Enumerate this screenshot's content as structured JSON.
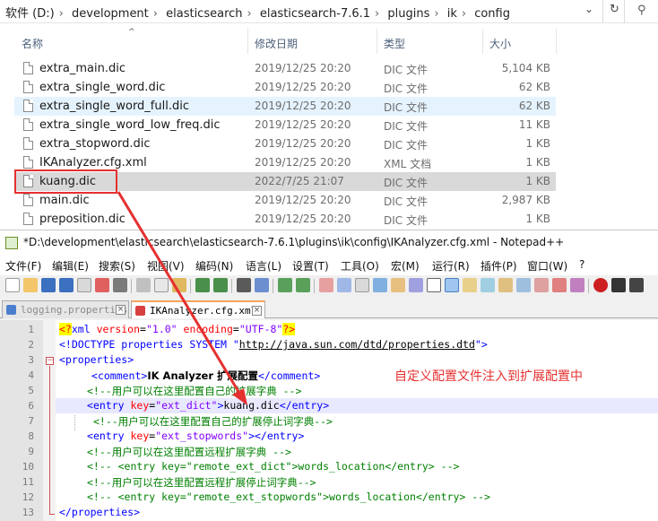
{
  "explorer": {
    "breadcrumb": [
      "软件 (D:)",
      "development",
      "elasticsearch",
      "elasticsearch-7.6.1",
      "plugins",
      "ik",
      "config"
    ],
    "columns": {
      "name": "名称",
      "date": "修改日期",
      "type": "类型",
      "size": "大小"
    },
    "files": [
      {
        "name": "extra_main.dic",
        "date": "2019/12/25 20:20",
        "type": "DIC 文件",
        "size": "5,104 KB"
      },
      {
        "name": "extra_single_word.dic",
        "date": "2019/12/25 20:20",
        "type": "DIC 文件",
        "size": "62 KB"
      },
      {
        "name": "extra_single_word_full.dic",
        "date": "2019/12/25 20:20",
        "type": "DIC 文件",
        "size": "62 KB"
      },
      {
        "name": "extra_single_word_low_freq.dic",
        "date": "2019/12/25 20:20",
        "type": "DIC 文件",
        "size": "11 KB"
      },
      {
        "name": "extra_stopword.dic",
        "date": "2019/12/25 20:20",
        "type": "DIC 文件",
        "size": "1 KB"
      },
      {
        "name": "IKAnalyzer.cfg.xml",
        "date": "2019/12/25 20:20",
        "type": "XML 文档",
        "size": "1 KB"
      },
      {
        "name": "kuang.dic",
        "date": "2022/7/25 21:07",
        "type": "DIC 文件",
        "size": "1 KB"
      },
      {
        "name": "main.dic",
        "date": "2019/12/25 20:20",
        "type": "DIC 文件",
        "size": "2,987 KB"
      },
      {
        "name": "preposition.dic",
        "date": "2019/12/25 20:20",
        "type": "DIC 文件",
        "size": "1 KB"
      }
    ]
  },
  "notepad": {
    "title": "*D:\\development\\elasticsearch\\elasticsearch-7.6.1\\plugins\\ik\\config\\IKAnalyzer.cfg.xml - Notepad++",
    "menu": [
      "文件(F)",
      "编辑(E)",
      "搜索(S)",
      "视图(V)",
      "编码(N)",
      "语言(L)",
      "设置(T)",
      "工具(O)",
      "宏(M)",
      "运行(R)",
      "插件(P)",
      "窗口(W)",
      "?"
    ],
    "tabs": [
      {
        "label": "logging.properties",
        "active": false
      },
      {
        "label": "IKAnalyzer.cfg.xml",
        "active": true
      }
    ],
    "line_numbers": [
      "1",
      "2",
      "3",
      "4",
      "5",
      "6",
      "7",
      "8",
      "9",
      "10",
      "11",
      "12",
      "13"
    ],
    "code": {
      "l1": {
        "a": "<?",
        "b": "xml",
        "c": " version",
        "d": "=",
        "e": "\"1.0\"",
        "f": " encoding",
        "g": "=",
        "h": "\"UTF-8\"",
        "i": "?>"
      },
      "l2": {
        "a": "<!DOCTYPE properties SYSTEM \"",
        "url": "http://java.sun.com/dtd/properties.dtd",
        "b": "\">"
      },
      "l3": {
        "a": "<",
        "tag": "properties",
        "b": ">"
      },
      "l4": {
        "a": "<",
        "tag": "comment",
        "b": ">",
        "text": "IK Analyzer 扩展配置",
        "c": "</",
        "d": "comment",
        "e": ">"
      },
      "l5": {
        "text": "<!--用户可以在这里配置自己的扩展字典 -->"
      },
      "l6": {
        "a": "<",
        "tag": "entry",
        "attr": " key",
        "eq": "=",
        "val": "\"ext_dict\"",
        "b": ">",
        "text": "kuang.dic",
        "c": "</",
        "d": "entry",
        "e": ">"
      },
      "l7": {
        "text": "<!--用户可以在这里配置自己的扩展停止词字典-->"
      },
      "l8": {
        "a": "<",
        "tag": "entry",
        "attr": " key",
        "eq": "=",
        "val": "\"ext_stopwords\"",
        "b": "></",
        "d": "entry",
        "e": ">"
      },
      "l9": {
        "text": "<!--用户可以在这里配置远程扩展字典 -->"
      },
      "l10": {
        "text": "<!-- <entry key=\"remote_ext_dict\">words_location</entry> -->"
      },
      "l11": {
        "text": "<!--用户可以在这里配置远程扩展停止词字典-->"
      },
      "l12": {
        "text": "<!-- <entry key=\"remote_ext_stopwords\">words_location</entry> -->"
      },
      "l13": {
        "a": "</",
        "tag": "properties",
        "b": ">"
      }
    }
  },
  "annotation": {
    "note": "自定义配置文件注入到扩展配置中",
    "color": "#e53030"
  },
  "colors": {
    "accent_red": "#e53030",
    "xml_tag": "#0000ff",
    "xml_comment": "#008000",
    "xml_attr": "#ff0000",
    "xml_value": "#8000ff"
  }
}
